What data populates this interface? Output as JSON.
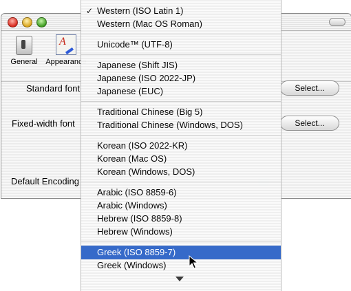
{
  "window": {
    "toolbar": {
      "general_label": "General",
      "appearance_label": "Appearance"
    },
    "fields": {
      "standard_font_label": "Standard font",
      "fixed_width_font_label": "Fixed-width font",
      "default_encoding_label": "Default Encoding",
      "select_button_1": "Select...",
      "select_button_2": "Select..."
    }
  },
  "encoding_menu": {
    "selected": "Western (ISO Latin 1)",
    "highlighted": "Greek (ISO 8859-7)",
    "check_glyph": "✓",
    "groups": [
      [
        "Western (ISO Latin 1)",
        "Western (Mac OS Roman)"
      ],
      [
        "Unicode™ (UTF-8)"
      ],
      [
        "Japanese (Shift JIS)",
        "Japanese (ISO 2022-JP)",
        "Japanese (EUC)"
      ],
      [
        "Traditional Chinese (Big 5)",
        "Traditional Chinese (Windows, DOS)"
      ],
      [
        "Korean (ISO 2022-KR)",
        "Korean (Mac OS)",
        "Korean (Windows, DOS)"
      ],
      [
        "Arabic (ISO 8859-6)",
        "Arabic (Windows)",
        "Hebrew (ISO 8859-8)",
        "Hebrew (Windows)"
      ],
      [
        "Greek (ISO 8859-7)",
        "Greek (Windows)"
      ]
    ],
    "scroll_indicator": "scroll-down-arrow-icon"
  },
  "colors": {
    "highlight": "#3066c8",
    "highlight_text": "#ffffff"
  }
}
